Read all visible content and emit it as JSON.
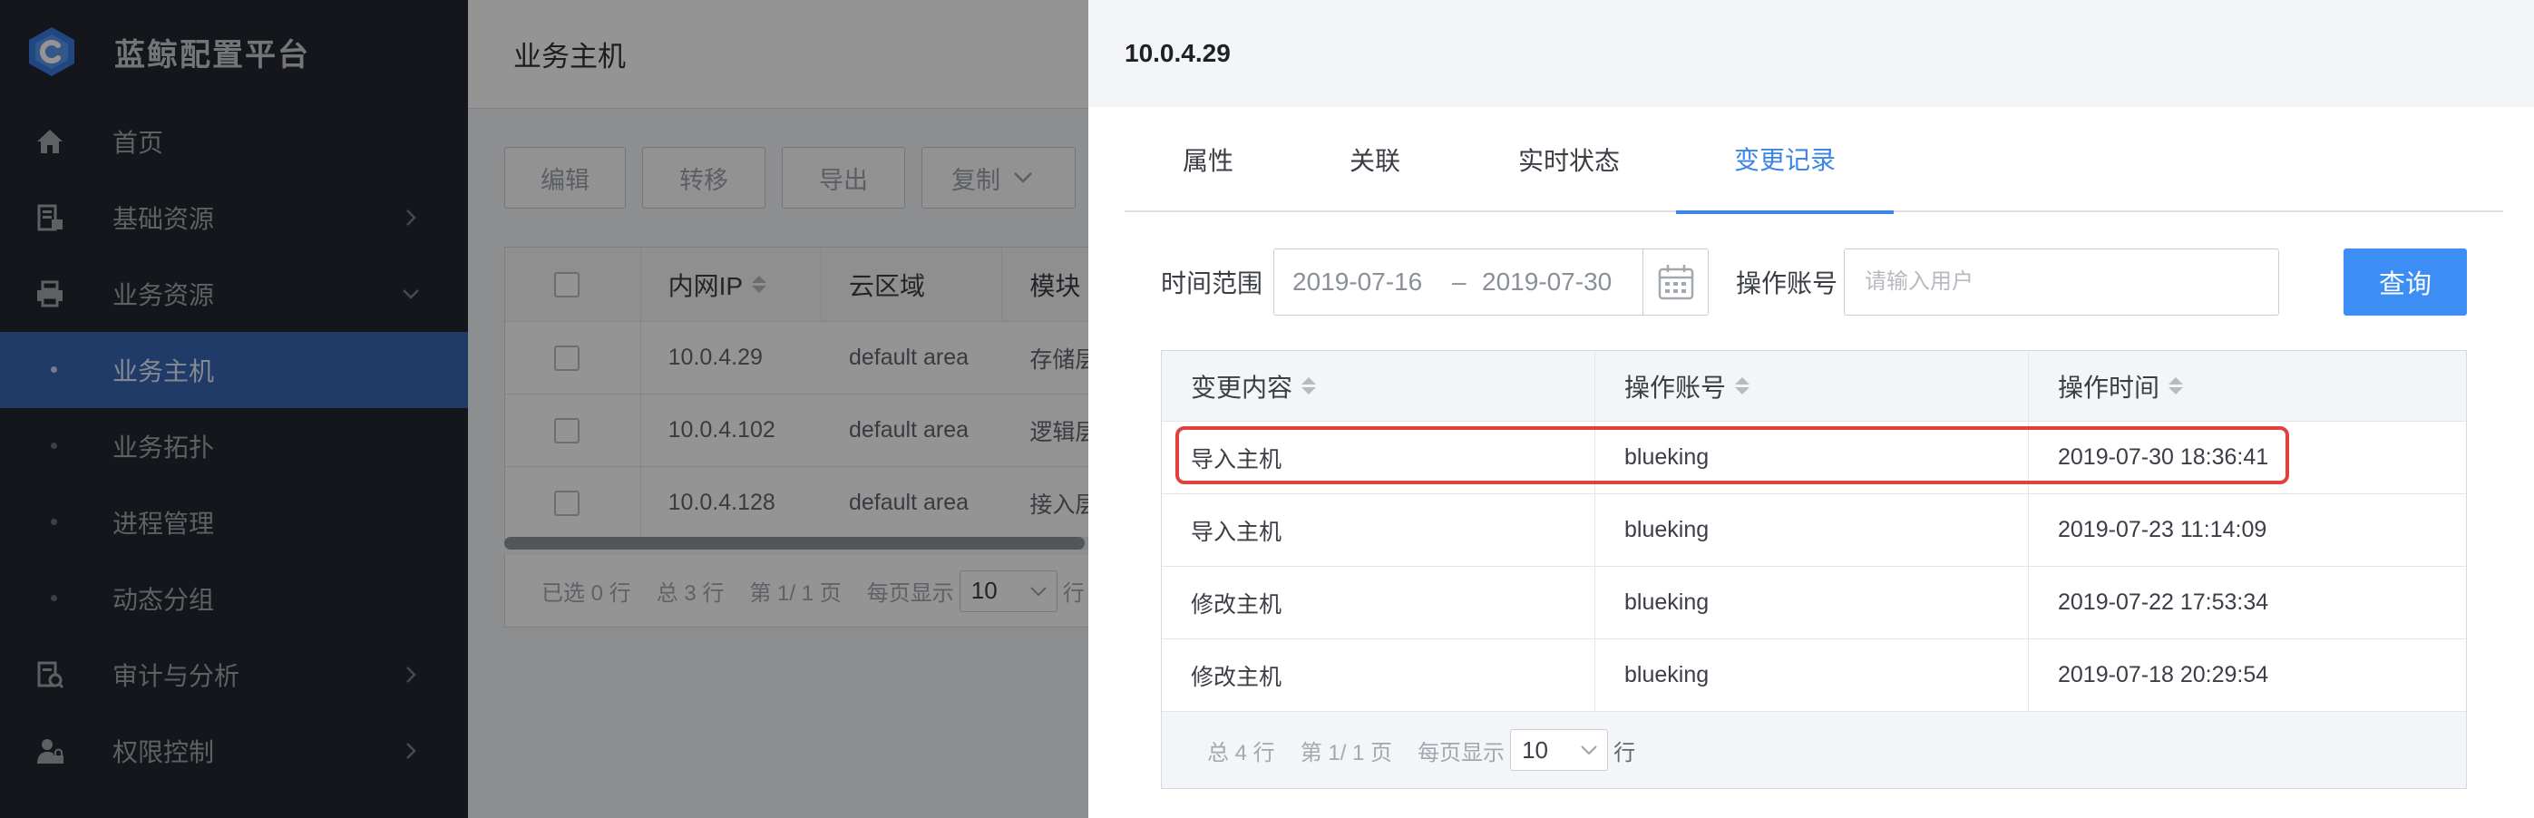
{
  "app": {
    "title": "蓝鲸配置平台",
    "accent": "#3a66b3"
  },
  "sidebar": {
    "items": [
      {
        "label": "首页",
        "icon": "home-icon"
      },
      {
        "label": "基础资源",
        "icon": "resource-icon"
      },
      {
        "label": "业务资源",
        "icon": "printer-icon"
      },
      {
        "label": "业务主机"
      },
      {
        "label": "业务拓扑"
      },
      {
        "label": "进程管理"
      },
      {
        "label": "动态分组"
      },
      {
        "label": "审计与分析",
        "icon": "audit-icon"
      },
      {
        "label": "权限控制",
        "icon": "user-lock-icon"
      }
    ]
  },
  "main": {
    "title": "业务主机",
    "toolbar": {
      "edit": "编辑",
      "transfer": "转移",
      "export": "导出",
      "copy": "复制"
    },
    "table": {
      "columns": [
        "内网IP",
        "云区域",
        "模块"
      ],
      "rows": [
        [
          "10.0.4.29",
          "default area",
          "存储层"
        ],
        [
          "10.0.4.102",
          "default area",
          "逻辑层"
        ],
        [
          "10.0.4.128",
          "default area",
          "接入层"
        ]
      ]
    },
    "footer": {
      "selected": "已选 0 行",
      "total": "总 3 行",
      "page": "第 1/ 1 页",
      "per_page_label": "每页显示",
      "per_page": "10",
      "suffix": "行"
    }
  },
  "panel": {
    "title": "10.0.4.29",
    "tabs": [
      "属性",
      "关联",
      "实时状态",
      "变更记录"
    ],
    "active_tab": "变更记录",
    "filter": {
      "time_label": "时间范围",
      "date_start": "2019-07-16",
      "date_sep": "–",
      "date_end": "2019-07-30",
      "account_label": "操作账号",
      "account_placeholder": "请输入用户",
      "query": "查询"
    },
    "table": {
      "columns": [
        "变更内容",
        "操作账号",
        "操作时间"
      ],
      "rows": [
        [
          "导入主机",
          "blueking",
          "2019-07-30 18:36:41"
        ],
        [
          "导入主机",
          "blueking",
          "2019-07-23 11:14:09"
        ],
        [
          "修改主机",
          "blueking",
          "2019-07-22 17:53:34"
        ],
        [
          "修改主机",
          "blueking",
          "2019-07-18 20:29:54"
        ]
      ]
    },
    "footer": {
      "total": "总 4 行",
      "page": "第 1/ 1 页",
      "per_page_label": "每页显示",
      "per_page": "10",
      "suffix": "行"
    },
    "highlight_color": "#e0413d"
  }
}
